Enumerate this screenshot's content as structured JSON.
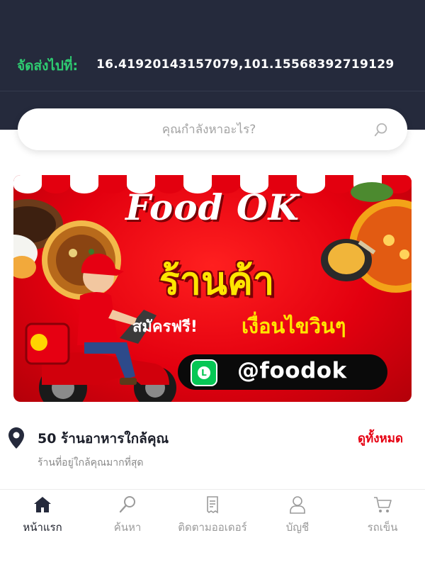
{
  "header": {
    "deliver_label": "จัดส่งไปที่:",
    "deliver_location": "16.41920143157079,101.15568392719129"
  },
  "search": {
    "placeholder": "คุณกำลังหาอะไร?"
  },
  "banner": {
    "title": "Food OK",
    "shop": "ร้านค้า",
    "free_text": "สมัครฟรี!",
    "conditions": "เงื่อนไขวินๆ",
    "line_icon_letter": "L",
    "line_handle": "@foodok",
    "colors": {
      "background": "#e3000f",
      "headline": "#ffe600",
      "line_green": "#06c755"
    }
  },
  "nearby": {
    "title": "50 ร้านอาหารใกล้คุณ",
    "subtitle": "ร้านที่อยู่ใกล้คุณมากที่สุด",
    "view_all": "ดูทั้งหมด",
    "icon": "map-pin-icon"
  },
  "nav": {
    "items": [
      {
        "label": "หน้าแรก",
        "icon": "home-icon",
        "active": true
      },
      {
        "label": "ค้นหา",
        "icon": "search-icon",
        "active": false
      },
      {
        "label": "ติดตามออเดอร์",
        "icon": "receipt-icon",
        "active": false
      },
      {
        "label": "บัญชี",
        "icon": "user-icon",
        "active": false
      },
      {
        "label": "รถเข็น",
        "icon": "cart-icon",
        "active": false
      }
    ]
  },
  "colors": {
    "header_bg": "#252a3c",
    "accent_green": "#2ecc71",
    "accent_red": "#e60012"
  }
}
